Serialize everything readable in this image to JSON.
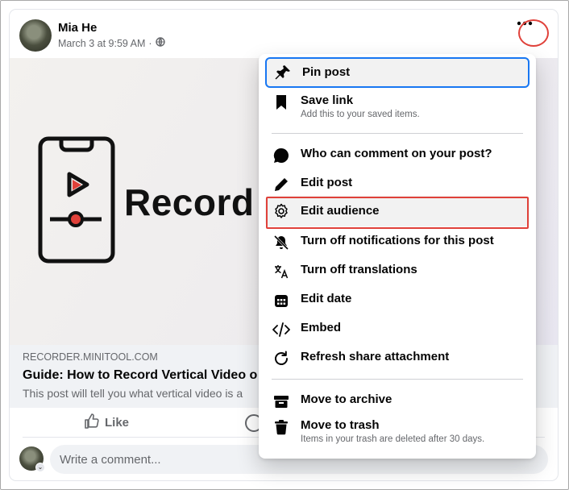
{
  "post": {
    "author": "Mia He",
    "timestamp": "March 3 at 9:59 AM",
    "separator": "·",
    "hero_text": "Record",
    "link": {
      "domain": "RECORDER.MINITOOL.COM",
      "title": "Guide: How to Record Vertical Video o",
      "description": "This post will tell you what vertical video is a"
    },
    "like_label": "Like",
    "comment_placeholder": "Write a comment..."
  },
  "menu": {
    "pin": {
      "label": "Pin post"
    },
    "save": {
      "label": "Save link",
      "sub": "Add this to your saved items."
    },
    "who_comment": {
      "label": "Who can comment on your post?"
    },
    "edit_post": {
      "label": "Edit post"
    },
    "edit_audience": {
      "label": "Edit audience"
    },
    "notifications": {
      "label": "Turn off notifications for this post"
    },
    "translations": {
      "label": "Turn off translations"
    },
    "edit_date": {
      "label": "Edit date"
    },
    "embed": {
      "label": "Embed"
    },
    "refresh": {
      "label": "Refresh share attachment"
    },
    "archive": {
      "label": "Move to archive"
    },
    "trash": {
      "label": "Move to trash",
      "sub": "Items in your trash are deleted after 30 days."
    }
  },
  "colors": {
    "highlight_red": "#e0413a",
    "focus_blue": "#1877f2",
    "logo_red": "#e0413a",
    "secondary_text": "#65676b"
  },
  "icons": {
    "pin": "pin-icon",
    "save": "bookmark-icon",
    "who_comment": "speech-bubble-icon",
    "edit_post": "pencil-icon",
    "edit_audience": "gear-icon",
    "notifications": "bell-off-icon",
    "translations": "translate-icon",
    "edit_date": "calendar-icon",
    "embed": "code-icon",
    "refresh": "refresh-icon",
    "archive": "archive-box-icon",
    "trash": "trash-icon",
    "more": "more-dots-icon",
    "globe": "globe-icon",
    "like": "thumbs-up-icon"
  }
}
